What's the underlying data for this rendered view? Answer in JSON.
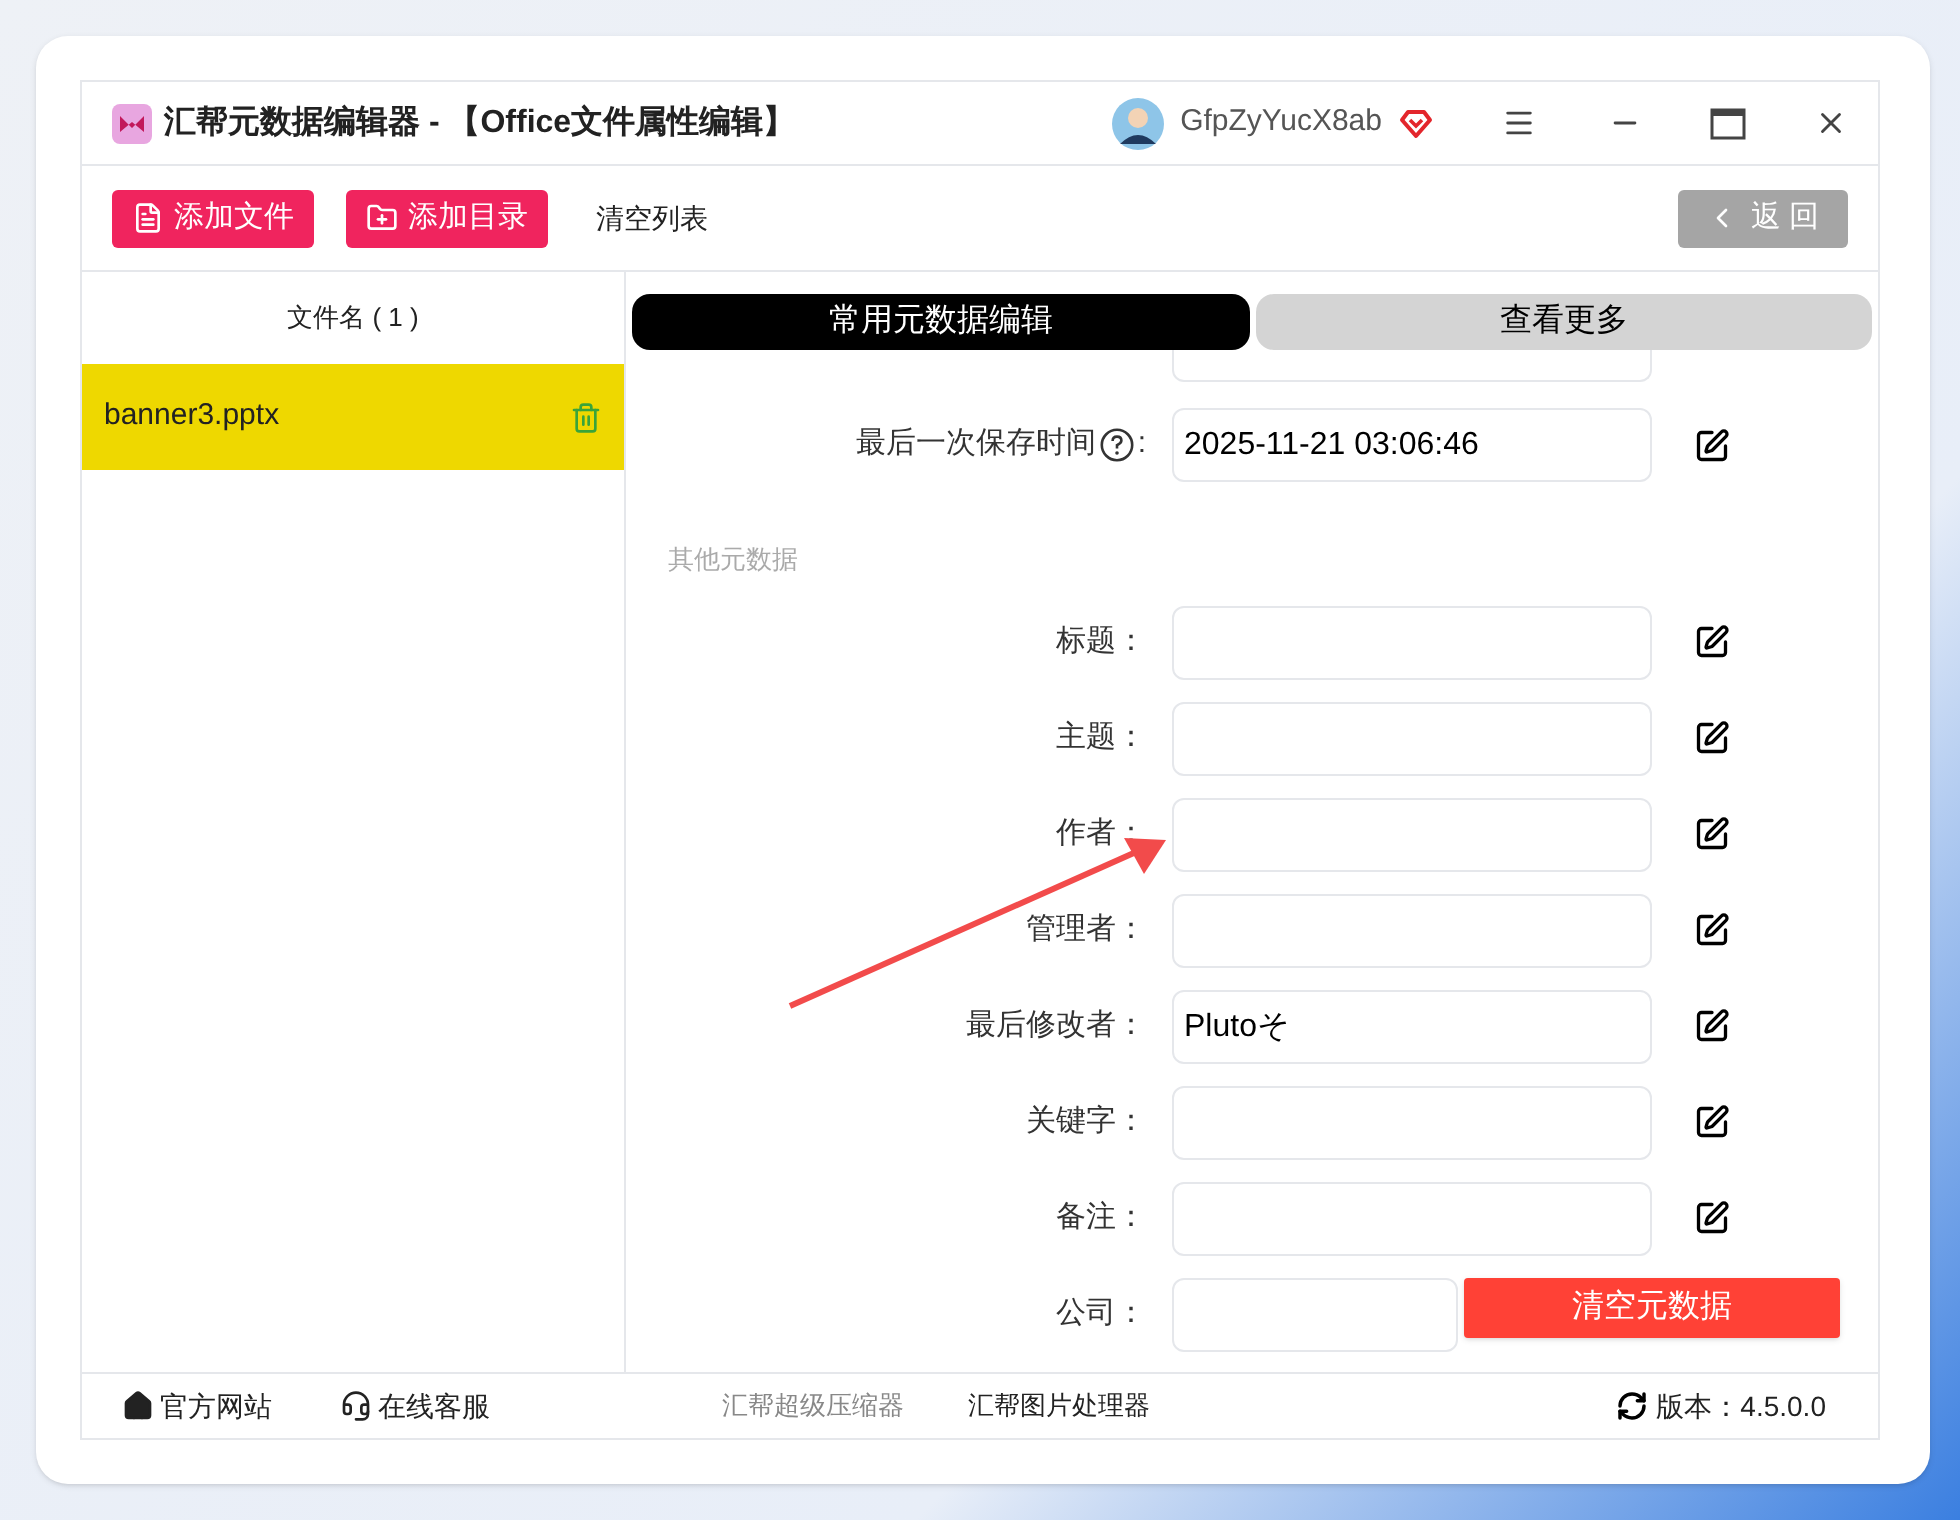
{
  "window": {
    "title": "汇帮元数据编辑器 - 【Office文件属性编辑】",
    "username": "GfpZyYucX8ab"
  },
  "toolbar": {
    "buttons": [
      {
        "label": "添加文件",
        "kind": "file"
      },
      {
        "label": "添加目录",
        "kind": "folder"
      },
      {
        "label": "清空列表",
        "kind": "plain"
      }
    ],
    "back_button": "返 回"
  },
  "file_list": {
    "header": "文件名 ( 1 )",
    "items": [
      {
        "name": "banner3.pptx",
        "selected": true
      }
    ]
  },
  "tabs": [
    {
      "label": "常用元数据编辑",
      "selected": true
    },
    {
      "label": "查看更多",
      "selected": false
    }
  ],
  "time_fields": [
    {
      "label": "最后一次保存时间",
      "colon": ":",
      "value": "2025-11-21 03:06:46"
    }
  ],
  "section_title": "其他元数据",
  "fields": [
    {
      "label": "标题："
    },
    {
      "label": "主题："
    },
    {
      "label": "作者："
    },
    {
      "label": "管理者："
    },
    {
      "label": "最后修改者：",
      "value": "Plutoそ"
    },
    {
      "label": "关键字："
    },
    {
      "label": "备注："
    },
    {
      "label": "公司："
    }
  ],
  "clear_button": "清空元数据",
  "footer": {
    "links": [
      {
        "label": "官方网站",
        "kind": "home"
      },
      {
        "label": "在线客服",
        "kind": "support"
      }
    ],
    "products": [
      {
        "label": "汇帮超级压缩器",
        "dimmed": true
      },
      {
        "label": "汇帮图片处理器",
        "dimmed": false
      }
    ],
    "version": "版本：4.5.0.0"
  }
}
